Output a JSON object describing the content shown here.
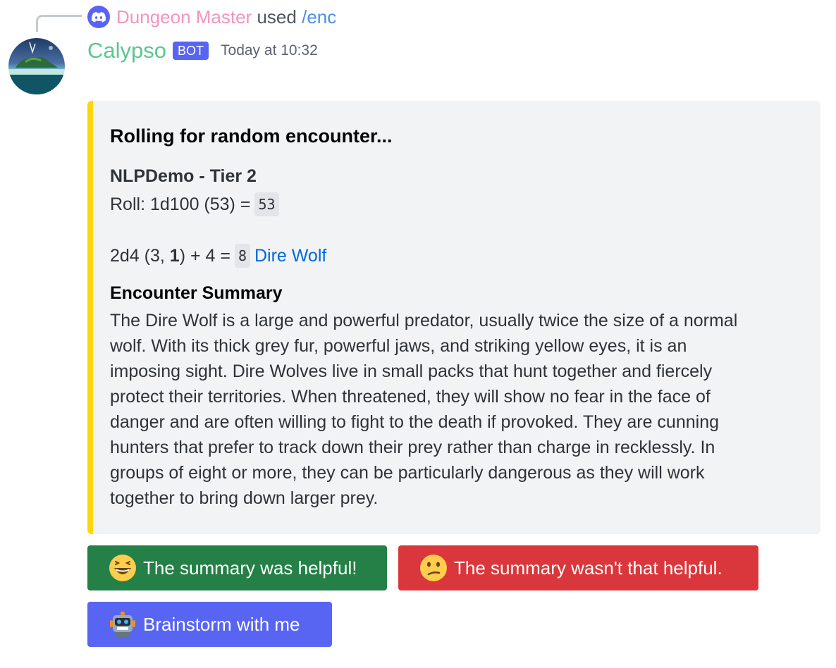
{
  "reply": {
    "user": "Dungeon Master",
    "used": "used",
    "command": "/enc",
    "icon": "discord-icon"
  },
  "message": {
    "author": "Calypso",
    "bot_tag": "BOT",
    "timestamp": "Today at 10:32",
    "author_color": "#58c88e"
  },
  "embed": {
    "accent_color": "#ffd60a",
    "title": "Rolling for random encounter...",
    "tier": "NLPDemo - Tier 2",
    "roll_text": "Roll: 1d100 (53) =",
    "roll_result": "53",
    "dice_prefix": "2d4 (3, ",
    "dice_bold": "1",
    "dice_suffix": ") + 4 =",
    "dice_result": "8",
    "monster_link": "Dire Wolf",
    "summary_title": "Encounter Summary",
    "summary_lines": [
      "The Dire Wolf is a large and powerful predator, usually twice the size of a normal",
      "wolf. With its thick grey fur, powerful jaws, and striking yellow eyes, it is an",
      "imposing sight. Dire Wolves live in small packs that hunt together and fiercely",
      "protect their territories. When threatened, they will show no fear in the face of",
      "danger and are often willing to fight to the death if provoked. They are cunning",
      "hunters that prefer to track down their prey rather than charge in recklessly. In",
      "groups of eight or more, they can be particularly dangerous as they will work",
      "together to bring down larger prey."
    ]
  },
  "buttons": {
    "helpful": {
      "label": "The summary was helpful!",
      "icon": "grinning-face-icon",
      "color": "#248046"
    },
    "not_helpful": {
      "label": "The summary wasn't that helpful.",
      "icon": "confused-face-icon",
      "color": "#da373c"
    },
    "brainstorm": {
      "label": "Brainstorm with me",
      "icon": "robot-icon",
      "color": "#5865f2"
    }
  }
}
